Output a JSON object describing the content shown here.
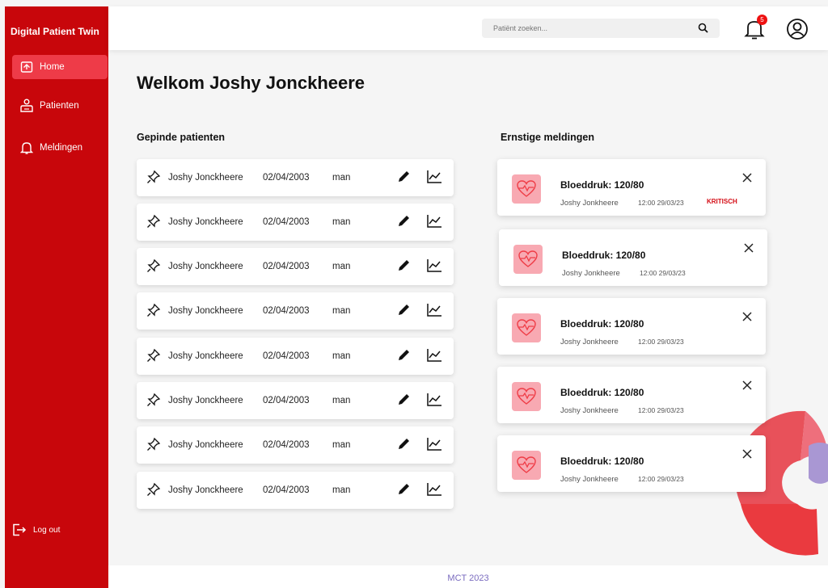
{
  "brand": "Digital Patient Twin",
  "nav": {
    "home": "Home",
    "patients": "Patienten",
    "notifications": "Meldingen",
    "logout": "Log out"
  },
  "search": {
    "placeholder": "Patiënt zoeken..."
  },
  "notifications_count": "5",
  "welcome": "Welkom Joshy Jonckheere",
  "pinned_title": "Gepinde patienten",
  "alerts_title": "Ernstige meldingen",
  "patients": [
    {
      "name": "Joshy Jonckheere",
      "dob": "02/04/2003",
      "gender": "man"
    },
    {
      "name": "Joshy Jonckheere",
      "dob": "02/04/2003",
      "gender": "man"
    },
    {
      "name": "Joshy Jonckheere",
      "dob": "02/04/2003",
      "gender": "man"
    },
    {
      "name": "Joshy Jonckheere",
      "dob": "02/04/2003",
      "gender": "man"
    },
    {
      "name": "Joshy Jonckheere",
      "dob": "02/04/2003",
      "gender": "man"
    },
    {
      "name": "Joshy Jonckheere",
      "dob": "02/04/2003",
      "gender": "man"
    },
    {
      "name": "Joshy Jonckheere",
      "dob": "02/04/2003",
      "gender": "man"
    },
    {
      "name": "Joshy Jonckheere",
      "dob": "02/04/2003",
      "gender": "man"
    }
  ],
  "alerts": [
    {
      "title": "Bloeddruk: 120/80",
      "name": "Joshy Jonkheere",
      "time": "12:00  29/03/23",
      "status": "KRITISCH"
    },
    {
      "title": "Bloeddruk: 120/80",
      "name": "Joshy Jonkheere",
      "time": "12:00  29/03/23",
      "status": ""
    },
    {
      "title": "Bloeddruk: 120/80",
      "name": "Joshy Jonkheere",
      "time": "12:00  29/03/23",
      "status": ""
    },
    {
      "title": "Bloeddruk: 120/80",
      "name": "Joshy Jonkheere",
      "time": "12:00  29/03/23",
      "status": ""
    },
    {
      "title": "Bloeddruk: 120/80",
      "name": "Joshy Jonkheere",
      "time": "12:00  29/03/23",
      "status": ""
    }
  ],
  "footer": "MCT 2023",
  "colors": {
    "primary": "#c8060b",
    "active": "#ee3b48",
    "heart_bg": "#f8a9b2",
    "footer_text": "#7a6bbf"
  }
}
